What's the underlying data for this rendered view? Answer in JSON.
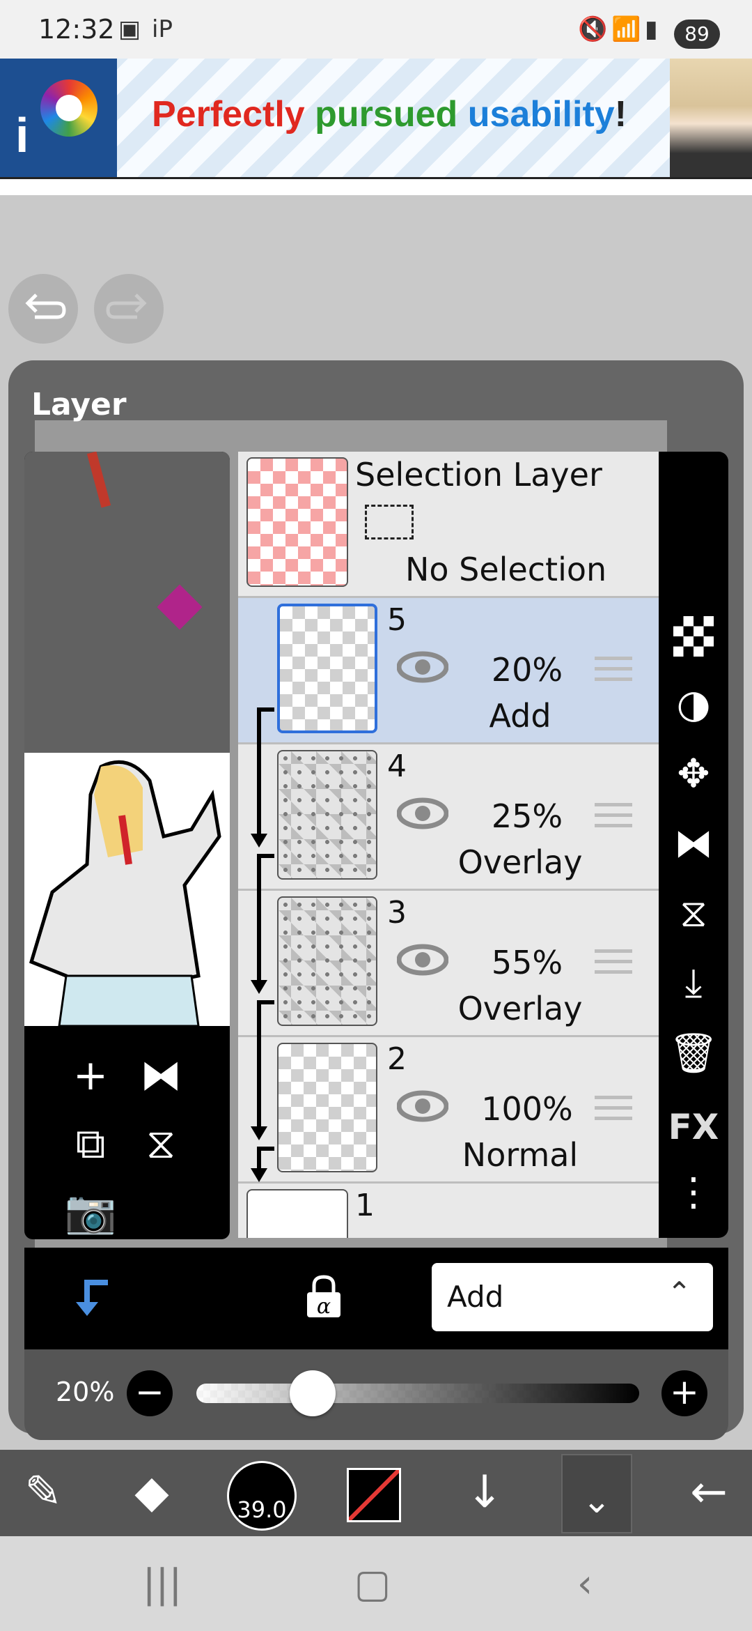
{
  "status_bar": {
    "time": "12:32",
    "battery": "89",
    "icons": [
      "screenshot-icon",
      "ibis-notification-icon",
      "mute-icon",
      "wifi-icon",
      "signal-icon"
    ]
  },
  "ad": {
    "slogan_word1": "Perfectly",
    "slogan_word2": "pursued",
    "slogan_word3": "usability",
    "slogan_end": "!",
    "colors": {
      "word1": "#e0281f",
      "word2": "#2e9a2e",
      "word3": "#1c7fd9"
    }
  },
  "panel": {
    "title": "Layer"
  },
  "selection_layer": {
    "title": "Selection Layer",
    "status": "No Selection"
  },
  "layers": [
    {
      "number": "5",
      "opacity": "20%",
      "mode": "Add",
      "selected": true
    },
    {
      "number": "4",
      "opacity": "25%",
      "mode": "Overlay",
      "selected": false
    },
    {
      "number": "3",
      "opacity": "55%",
      "mode": "Overlay",
      "selected": false
    },
    {
      "number": "2",
      "opacity": "100%",
      "mode": "Normal",
      "selected": false
    },
    {
      "number": "1"
    }
  ],
  "right_toolbar": {
    "fx_label": "FX"
  },
  "blend_mode": {
    "value": "Add"
  },
  "opacity": {
    "label": "20%",
    "value": 20
  },
  "brush": {
    "size": "39.0"
  },
  "colors": {
    "accent": "#2f6fdb",
    "selected_row": "#cbd8ec",
    "panel": "#666666"
  }
}
